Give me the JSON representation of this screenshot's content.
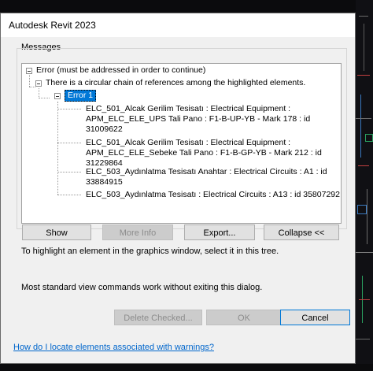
{
  "window": {
    "title": "Autodesk Revit 2023"
  },
  "messages": {
    "group_label": "Messages",
    "tree": {
      "error_header": "Error (must be addressed in order to continue)",
      "description": "There is a circular chain of references among the highlighted elements.",
      "error_node": "Error 1",
      "elements": [
        "ELC_501_Alcak Gerilim Tesisatı : Electrical Equipment :",
        "APM_ELC_ELE_UPS Tali Pano : F1-B-UP-YB - Mark 178 : id",
        "31009622",
        "ELC_501_Alcak Gerilim Tesisatı : Electrical Equipment :",
        "APM_ELC_ELE_Sebeke Tali Pano : F1-B-GP-YB - Mark 212 : id",
        "31229864",
        "ELC_503_Aydınlatma Tesisatı Anahtar : Electrical Circuits : A1 : id",
        "33884915",
        "ELC_503_Aydınlatma Tesisatı : Electrical Circuits : A13 : id 35807292"
      ]
    }
  },
  "buttons": {
    "show": "Show",
    "more_info": "More Info",
    "export": "Export...",
    "collapse": "Collapse <<",
    "delete_checked": "Delete Checked...",
    "ok": "OK",
    "cancel": "Cancel"
  },
  "hints": {
    "highlight": "To highlight an element in the graphics window, select it in this tree.",
    "view_commands": "Most standard view commands work without exiting this dialog."
  },
  "help_link": "How do I locate elements associated with warnings?"
}
